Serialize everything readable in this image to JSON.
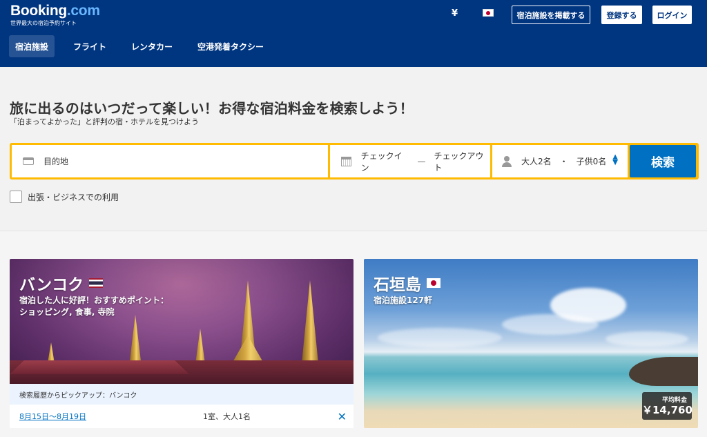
{
  "header": {
    "logo_main": "Booking",
    "logo_com": ".com",
    "logo_tagline": "世界最大の宿泊予約サイト",
    "currency": "¥",
    "list_property": "宿泊施設を掲載する",
    "register": "登録する",
    "login": "ログイン",
    "nav": [
      "宿泊施設",
      "フライト",
      "レンタカー",
      "空港発着タクシー"
    ]
  },
  "hero": {
    "headline": "旅に出るのはいつだって楽しい！お得な宿泊料金を検索しよう！",
    "subline": "「泊まってよかった」と評判の宿・ホテルを見つけよう",
    "destination_placeholder": "目的地",
    "checkin": "チェックイン",
    "date_dash": "—",
    "checkout": "チェックアウト",
    "adults": "大人2名",
    "guest_dot": "・",
    "children": "子供0名",
    "search_button": "検索",
    "business_label": "出張・ビジネスでの利用"
  },
  "cards": {
    "bangkok": {
      "title": "バンコク",
      "sub_line1": "宿泊した人に好評！おすすめポイント：",
      "sub_line2": "ショッピング, 食事, 寺院",
      "history_label": "検索履歴からピックアップ：バンコク",
      "dates": "8月15日〜8月19日",
      "rooms": "1室、大人1名"
    },
    "ishigaki": {
      "title": "石垣島",
      "sub": "宿泊施設127軒",
      "price_label": "平均料金",
      "price": "￥14,760"
    }
  },
  "colors": {
    "brand_blue": "#003580",
    "search_yellow": "#febb02",
    "action_blue": "#0071c2"
  }
}
